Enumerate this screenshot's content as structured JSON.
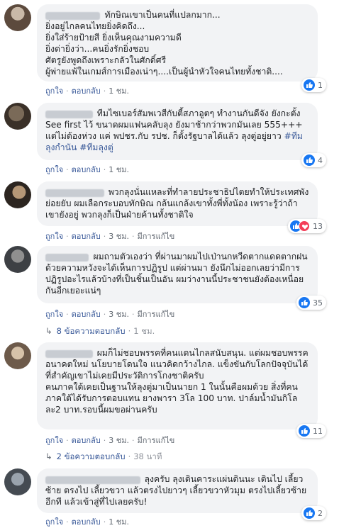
{
  "comments": [
    {
      "name": "xxxxxxxx xxxxxx",
      "text": "ทักษิณเขาเป็นคนที่แปลกมาก...\nยิ่งอยู่ไกลคนไทยยิ่งคิดถึง...\nยิ่งใส่ร้ายป้ายสี ยิ่งเห็นคุณงามความดี\nยิ่งด่ายิ่งว่า...คนยิ่งรักยิ่งชอบ\nศัตรูยังพูดถึงเพราะกลัวในศักดิ์ศรี\nผู้พ่ายแพ้ในเกมส์การเมืองเน่าๆ....เป็นผู้นำหัวใจคนไทยทั้งชาติ....",
      "like": "ถูกใจ",
      "reply": "ตอบกลับ",
      "time": "1 ชม.",
      "edited": "",
      "reactions": "1"
    },
    {
      "name": "xxxxxx xxxxxx",
      "text_before": "ทีมไซเบอร์สัมพเวสีกับตี้สภาอูตๆ ทำงานกันดีจัง ยังกะตั้ง See first ไว้ ขนาดผมแฟนคลับลุง ยังมาช้ากว่าพวกมันเลย 555+++ แต่ไม่ต้องห่วง แค่ พปชร.กับ รปช. ก็ตั้งรัฐบาลได้แล้ว ลุงตู่อยู่ยาว ",
      "hashtag1": "#ทีมลุงกำนัน",
      "hashtag2": "#ทีมลุงตู่",
      "like": "ถูกใจ",
      "reply": "ตอบกลับ",
      "time": "1 ชม.",
      "edited": "",
      "reactions": "4"
    },
    {
      "name": "xxxxxx xxxxxxxxx",
      "text": "พวกลุงนั่นแหละที่ทำลายประชาธิปไตยทำให้ประเทศพังย่อยยับ ผมเลือกระบอบทักษิณ กล้นแกล้งเขาทั้งพี่ทั้งน้อง เพราะรู้ว่าถ้าเขายังอยู่ พวกลุงก็เป็นฝ่ายค้านทั้งชาติใจ",
      "like": "ถูกใจ",
      "reply": "ตอบกลับ",
      "time": "3 ชม.",
      "edited": "มีการแก้ไข",
      "reactions": "13"
    },
    {
      "name": "xxxxxx xxxxx",
      "text": "ผมถามตัวเองว่า ที่ผ่านมาผมไปเป่านกหวีดตากแดดตากฝน ด้วยความหวังจะได้เห็นการปฏิรูป แต่ผ่านมา ยังนึกไม่ออกเลยว่ามีการปฏิรูปอะไรแล้วบ้างที่เป็นชิ้นเป็นอัน ผมว่างานนี้ประชาชนยังต้องเหนื่อยกันอีกเยอะแน่ๆ",
      "like": "ถูกใจ",
      "reply": "ตอบกลับ",
      "time": "3 ชม.",
      "edited": "มีการแก้ไข",
      "reactions": "35",
      "replies_label": "8 ข้อความตอบกลับ",
      "replies_time": "1 ชม."
    },
    {
      "name": "xxxxxxx xxxxx",
      "text": "ผมก็ไม่ชอบพรรคที่คนแดนไกลสนับสนุน. แต่ผมชอบพรรคอนาคตใหม่ นโยบายโดนใจ แนวคิดกว้างไกล. แข็งขันกับโลกปัจจุบันได้ ที่สำคัญเขาไม่เคยมีประวัติการโกงชาติครับ\nคนภาคใต้เคยเป็นฐานให้ลุงตู่มาเป็นนายก 1 ในนั้นคือผมด้วย สิ่งที่คนภาคใต้ได้รับการตอบแทน ยางพารา 3โล 100 บาท. ปาล์มน้ำมันกิโลละ2 บาท.รอบนี้ผมขอผ่านครับ",
      "like": "ถูกใจ",
      "reply": "ตอบกลับ",
      "time": "3 ชม.",
      "edited": "มีการแก้ไข",
      "reactions": "11",
      "replies_label": "2 ข้อความตอบกลับ",
      "replies_time": "38 นาที"
    },
    {
      "name": "xxxxxxxxx xxxxxx xxxxxxxxx",
      "text": "ลุงครับ ลุงเดินคาระแผ่นดินนะ เดินไป เลี้ยวซ้าย ตรงไป เลี้ยวขวา แล้วตรงไปยาวๆ เลี้ยวขวาหัวมุม ตรงไปเลี้ยวซ้ายอีกที แล้วเข้าสู่ที่ไปเลยครับ!",
      "like": "ถูกใจ",
      "reply": "ตอบกลับ",
      "time": "1 ชม.",
      "edited": "",
      "reactions": "2"
    }
  ],
  "colors": {
    "link": "#385898",
    "like": "#1877f2",
    "love": "#f33e58",
    "bubble": "#f2f3f5"
  },
  "icons": {
    "like": "thumbs-up-icon",
    "love": "heart-icon",
    "reply_arrow": "reply-arrow-icon"
  }
}
